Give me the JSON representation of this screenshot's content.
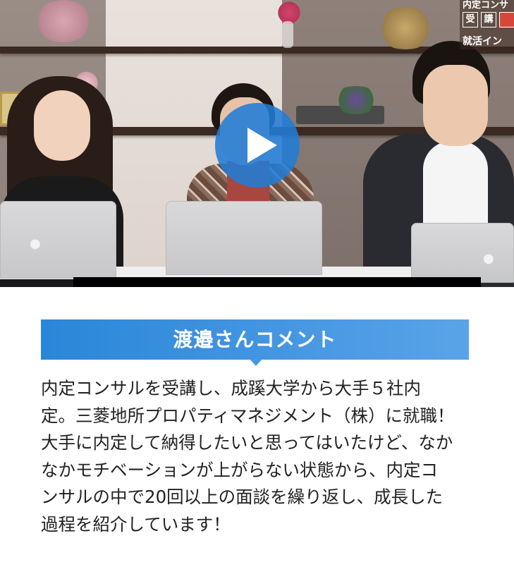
{
  "video": {
    "overlay_badge": {
      "line1": "内定コンサ",
      "boxes": [
        "受",
        "講",
        ""
      ],
      "line3": "就活イン"
    },
    "play_icon": "play-icon",
    "play_color": "#217cd6"
  },
  "comment": {
    "heading": "渡邉さんコメント",
    "heading_color": "#2a86d9",
    "body": "内定コンサルを受講し、成蹊大学から大手５社内\n定。三菱地所プロパティマネジメント（株）に就職！\n大手に内定して納得したいと思ってはいたけど、なか\nなかモチベーションが上がらない状態から、内定コ\nンサルの中で20回以上の面談を繰り返し、成長した\n過程を紹介しています！"
  }
}
